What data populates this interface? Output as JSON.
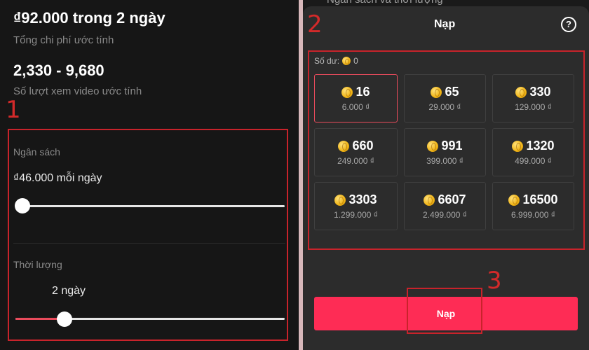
{
  "left": {
    "total_cost": "₫92.000 trong 2 ngày",
    "total_cost_label": "Tổng chi phí ước tính",
    "views": "2,330 - 9,680",
    "views_label": "Số lượt xem video ước tính",
    "budget": {
      "label": "Ngân sách",
      "value": "₫46.000 mỗi ngày",
      "slider_level": 0.03
    },
    "duration": {
      "label": "Thời lượng",
      "value": "2 ngày",
      "slider_level": 0.18
    }
  },
  "right": {
    "peek_title": "Ngân sách và thời lượng",
    "title": "Nạp",
    "help_glyph": "?",
    "balance_label": "Số dư:",
    "balance_value": "0",
    "packages": [
      {
        "coins": "16",
        "price": "6.000 ₫",
        "selected": true
      },
      {
        "coins": "65",
        "price": "29.000 ₫"
      },
      {
        "coins": "330",
        "price": "129.000 ₫"
      },
      {
        "coins": "660",
        "price": "249.000 ₫"
      },
      {
        "coins": "991",
        "price": "399.000 ₫"
      },
      {
        "coins": "1320",
        "price": "499.000 ₫"
      },
      {
        "coins": "3303",
        "price": "1.299.000 ₫"
      },
      {
        "coins": "6607",
        "price": "2.499.000 ₫"
      },
      {
        "coins": "16500",
        "price": "6.999.000 ₫"
      }
    ],
    "button_label": "Nạp"
  },
  "annotations": {
    "mark1": "1",
    "mark2": "2",
    "mark3": "3"
  },
  "colors": {
    "accent": "#fe2c55",
    "annotation": "#c8232b",
    "coin": "#f0b416"
  }
}
